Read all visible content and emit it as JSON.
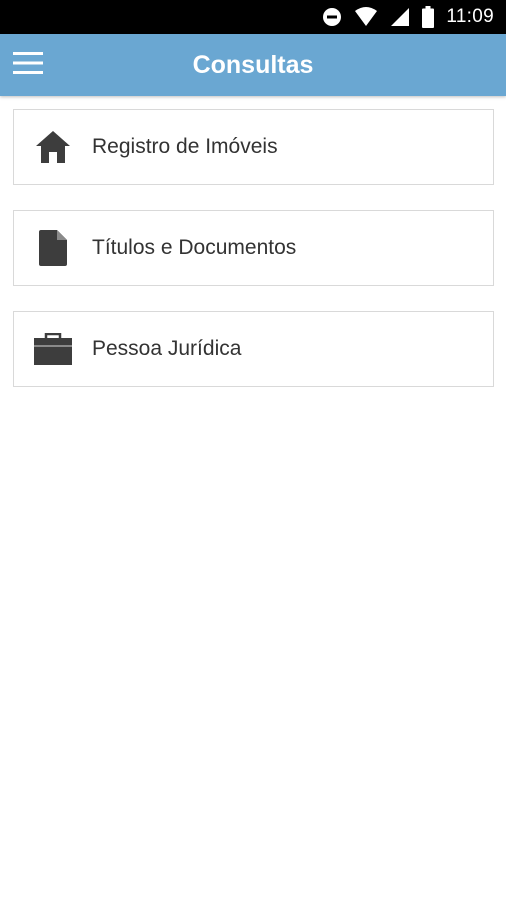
{
  "status_bar": {
    "time": "11:09",
    "icons": [
      "do-not-disturb-icon",
      "wifi-icon",
      "signal-icon",
      "battery-icon"
    ]
  },
  "app_bar": {
    "title": "Consultas",
    "menu_icon": "hamburger-menu-icon",
    "background_color": "#6aa7d2"
  },
  "menu_items": [
    {
      "label": "Registro de Imóveis",
      "icon": "home-icon"
    },
    {
      "label": "Títulos e Documentos",
      "icon": "document-icon"
    },
    {
      "label": "Pessoa Jurídica",
      "icon": "briefcase-icon"
    }
  ]
}
